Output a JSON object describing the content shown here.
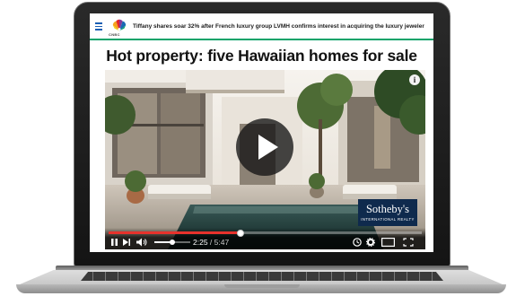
{
  "topbar": {
    "logo_text": "CNBC",
    "ticker": "Tiffany shares soar 32% after French luxury group LVMH confirms interest in acquiring the luxury jeweler"
  },
  "headline": "Hot property: five Hawaiian homes for sale",
  "video": {
    "brand_name": "Sotheby's",
    "brand_sub": "INTERNATIONAL REALTY",
    "current_time": "2:25",
    "duration": "5:47",
    "progress_fraction": 0.42,
    "volume_fraction": 0.5
  },
  "colors": {
    "accent_progress": "#e7322c",
    "topbar_rule": "#0aa36a",
    "brand_bg": "#0f2a4d"
  },
  "icons": [
    "menu-icon",
    "peacock-logo",
    "info-icon",
    "play-icon",
    "pause-icon",
    "next-icon",
    "volume-icon",
    "clock-icon",
    "gear-icon",
    "miniplayer-icon",
    "fullscreen-icon"
  ]
}
